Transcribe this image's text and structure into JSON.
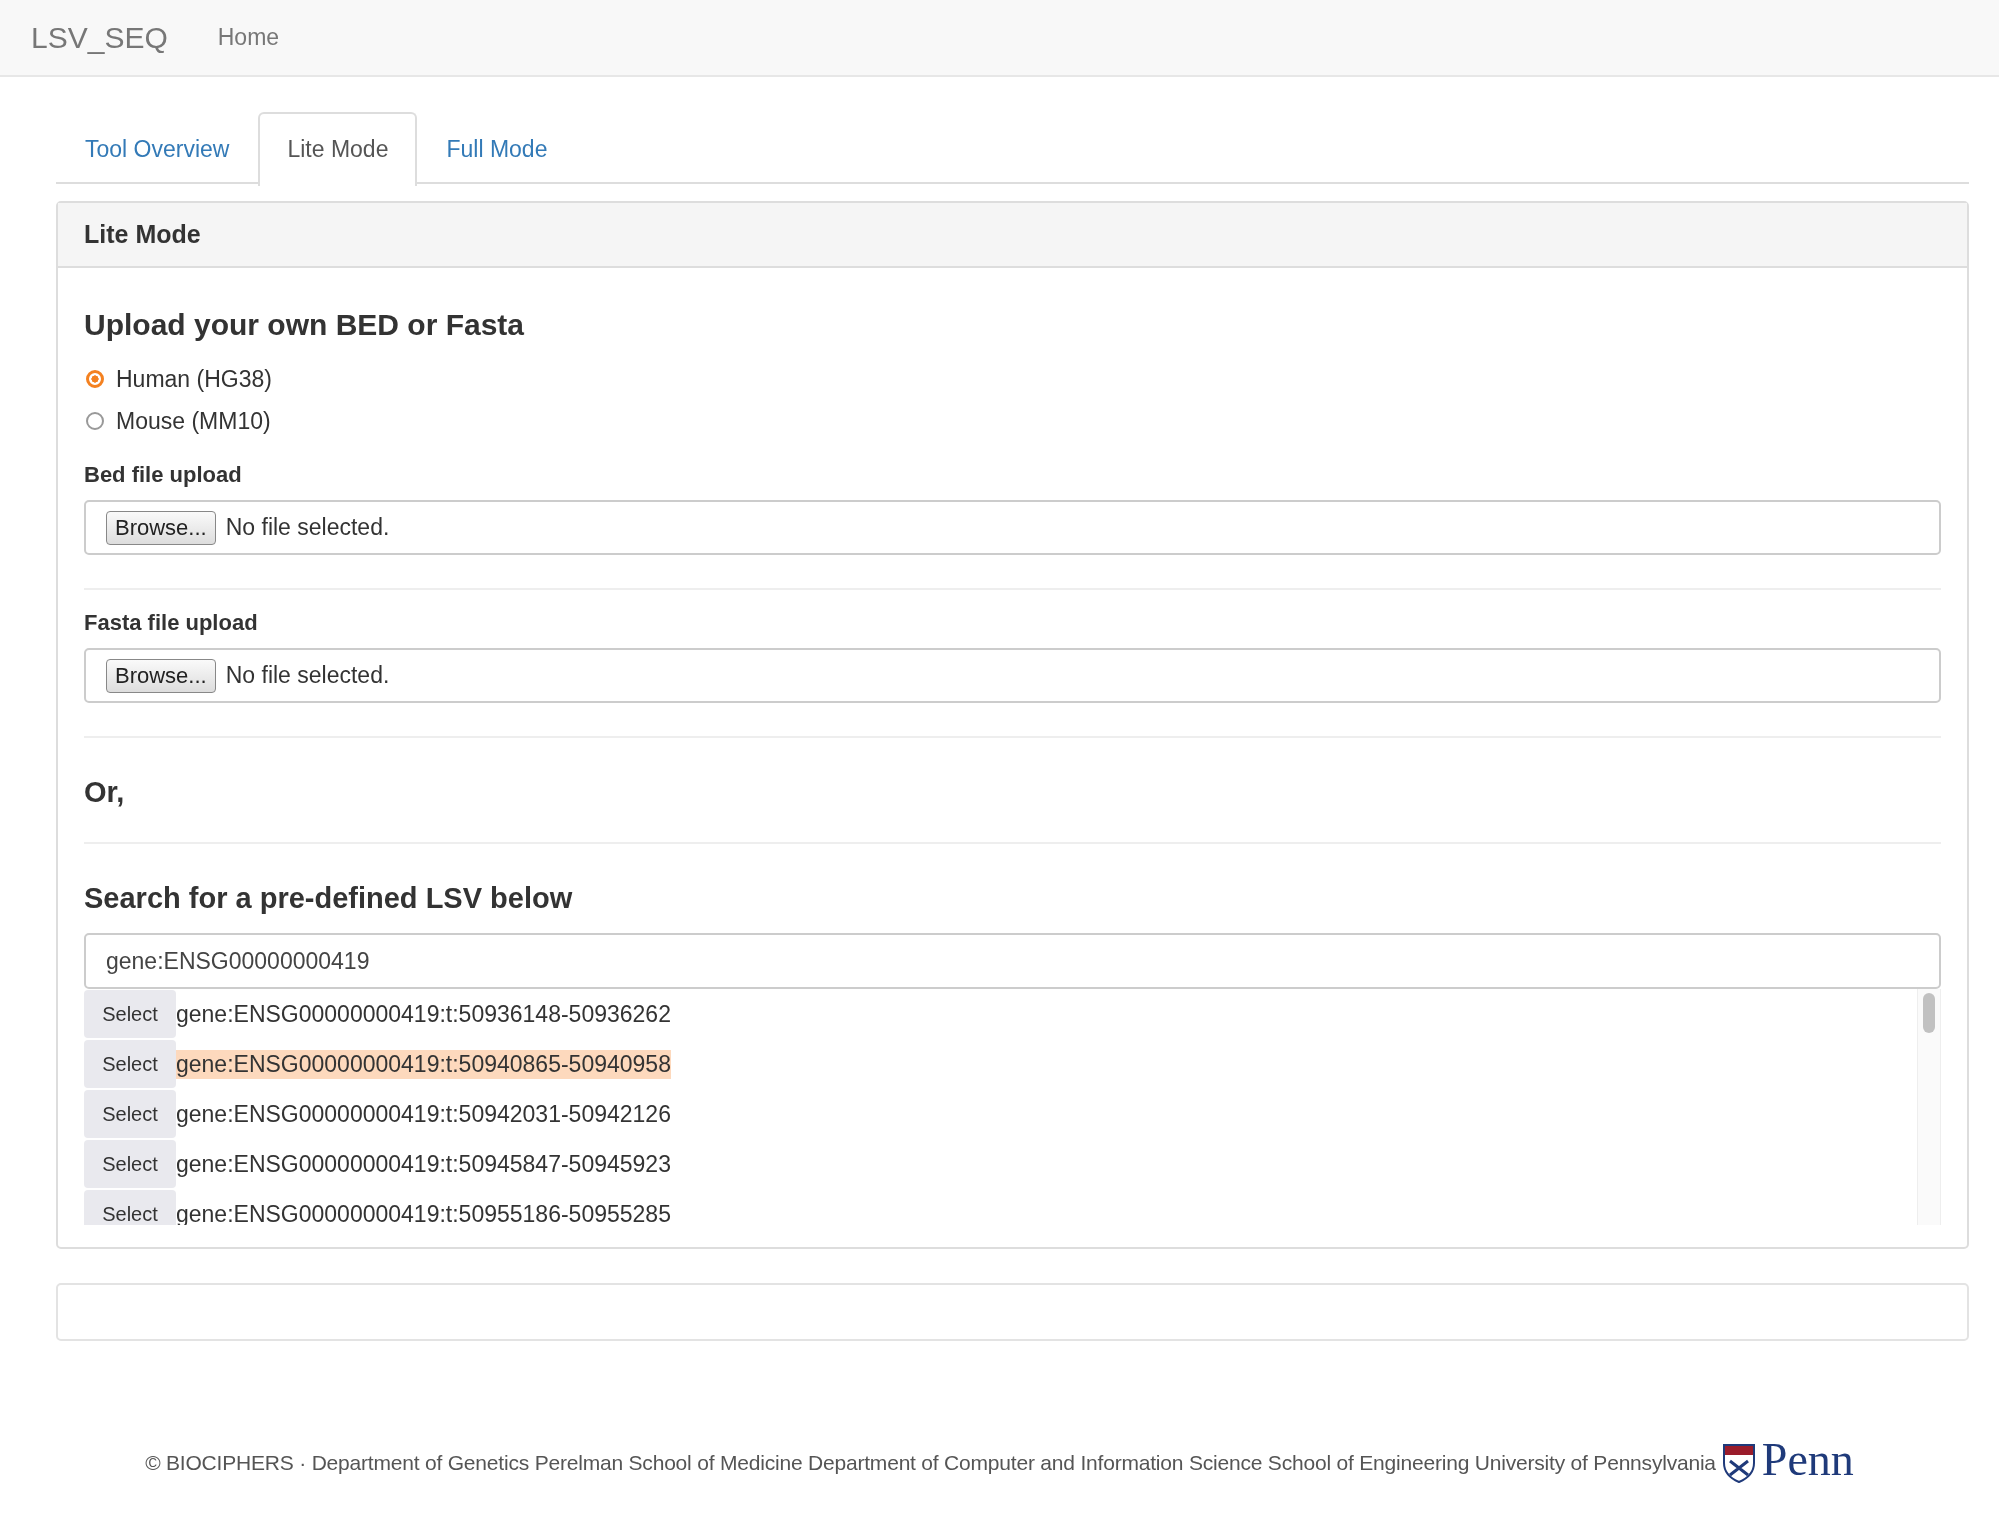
{
  "navbar": {
    "brand": "LSV_SEQ",
    "links": [
      {
        "label": "Home"
      }
    ]
  },
  "tabs": [
    {
      "label": "Tool Overview",
      "selected": false
    },
    {
      "label": "Lite Mode",
      "selected": true
    },
    {
      "label": "Full Mode",
      "selected": false
    }
  ],
  "panel": {
    "title": "Lite Mode",
    "upload_heading": "Upload your own BED or Fasta",
    "species": [
      {
        "label": "Human (HG38)",
        "selected": true
      },
      {
        "label": "Mouse (MM10)",
        "selected": false
      }
    ],
    "uploads": [
      {
        "label": "Bed file upload",
        "button": "Browse...",
        "status": "No file selected."
      },
      {
        "label": "Fasta file upload",
        "button": "Browse...",
        "status": "No file selected."
      }
    ],
    "or_text": "Or,",
    "search_heading": "Search for a pre-defined LSV below",
    "search_value": "gene:ENSG00000000419",
    "results": [
      {
        "button": "Select",
        "text": "gene:ENSG00000000419:t:50936148-50936262",
        "selected": false
      },
      {
        "button": "Select",
        "text": "gene:ENSG00000000419:t:50940865-50940958",
        "selected": true
      },
      {
        "button": "Select",
        "text": "gene:ENSG00000000419:t:50942031-50942126",
        "selected": false
      },
      {
        "button": "Select",
        "text": "gene:ENSG00000000419:t:50945847-50945923",
        "selected": false
      },
      {
        "button": "Select",
        "text": "gene:ENSG00000000419:t:50955186-50955285",
        "selected": false
      }
    ]
  },
  "footer": {
    "text": "© BIOCIPHERS · Department of Genetics Perelman School of Medicine Department of Computer and Information Science School of Engineering University of Pennsylvania",
    "logo_text": "Penn"
  }
}
